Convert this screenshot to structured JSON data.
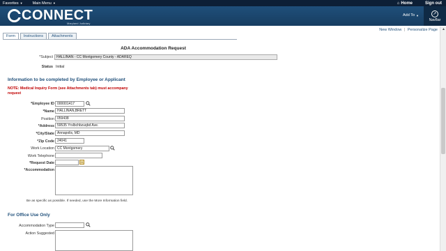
{
  "sysbar": {
    "favorites": "Favorites",
    "main_menu": "Main Menu",
    "home": "Home",
    "sign_out": "Sign out"
  },
  "brand": {
    "name": "CONNECT",
    "sub": "Maryland Judiciary",
    "add_to": "Add To",
    "navbar": "NavBar"
  },
  "links": {
    "new_window": "New Window",
    "personalize": "Personalize Page"
  },
  "tabs": [
    "Form",
    "Instructions",
    "Attachments"
  ],
  "form": {
    "title": "ADA Accommodation Request",
    "subject_label": "*Subject",
    "subject_value": "HALLINAN - CC Montgomery County - ADAREQ",
    "status_label": "Status",
    "status_value": "Initial"
  },
  "section1": {
    "title": "Information to be completed by Employee or Applicant",
    "note": "NOTE: Medical Inquiry Form (see Attachments tab) must accompany request"
  },
  "fields": {
    "employee_id_label": "*Employee ID",
    "employee_id_value": "000001417",
    "name_label": "*Name",
    "name_value": "HALLINAN,BRETT",
    "position_label": "Position",
    "position_value": "059438",
    "address_label": "*Address",
    "address_value": "59535 Yrslbchbzuqbd Ave.",
    "city_label": "*City/State",
    "city_value": "Annapolis, MD",
    "zip_label": "*Zip Code",
    "zip_value": "24041",
    "work_location_label": "Work Location",
    "work_location_value": "CC Montgomery",
    "work_phone_label": "Work Telephone",
    "work_phone_value": "",
    "request_date_label": "*Request Date",
    "request_date_value": "",
    "accommodation_label": "*Accommodation",
    "hint": "Be as specific as possible. If needed, use the More Information field."
  },
  "section2": {
    "title": "For Office Use Only",
    "accommodation_type_label": "Accommodation Type",
    "accommodation_type_value": "",
    "action_suggested_label": "Action Suggested"
  },
  "colors": {
    "brand": "#1f4f7a",
    "note_red": "#c00000"
  }
}
